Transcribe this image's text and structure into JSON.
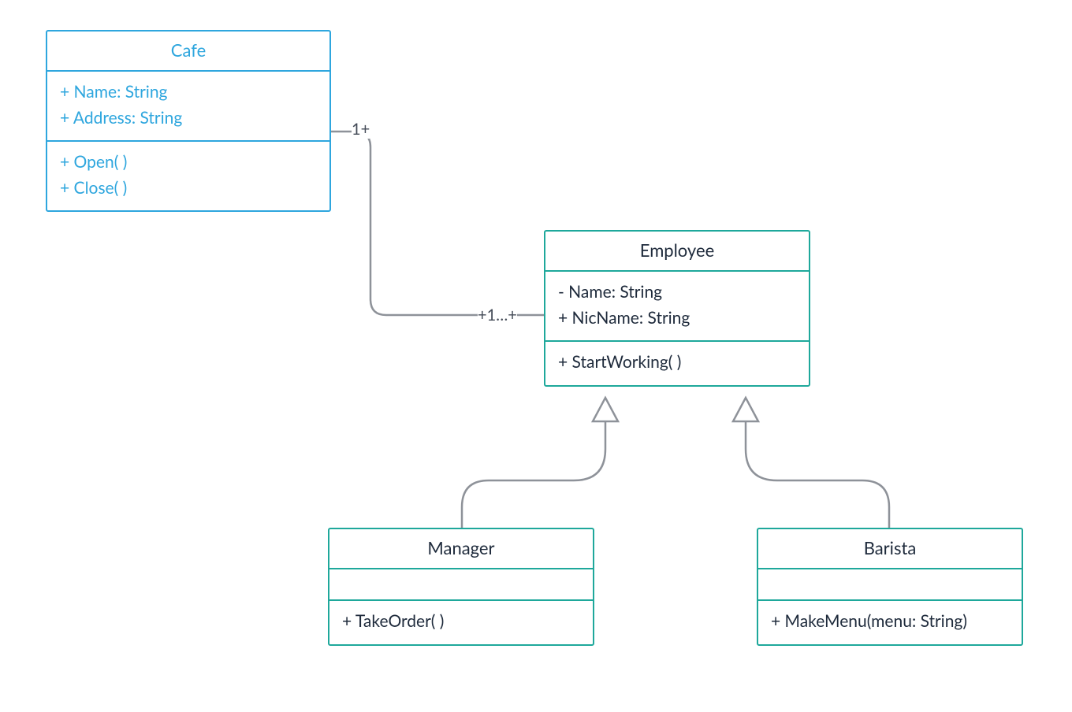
{
  "diagram": {
    "type": "uml-class-diagram",
    "classes": {
      "cafe": {
        "name": "Cafe",
        "attributes": [
          "+ Name: String",
          "+ Address: String"
        ],
        "operations": [
          "+ Open( )",
          "+ Close( )"
        ]
      },
      "employee": {
        "name": "Employee",
        "attributes": [
          "- Name: String",
          "+ NicName: String"
        ],
        "operations": [
          "+ StartWorking( )"
        ]
      },
      "manager": {
        "name": "Manager",
        "attributes": [],
        "operations": [
          "+ TakeOrder( )"
        ]
      },
      "barista": {
        "name": "Barista",
        "attributes": [],
        "operations": [
          "+ MakeMenu(menu: String)"
        ]
      }
    },
    "relationships": [
      {
        "from": "cafe",
        "to": "employee",
        "type": "association",
        "from_multiplicity": "1+",
        "to_multiplicity": "+1…+"
      },
      {
        "from": "manager",
        "to": "employee",
        "type": "generalization"
      },
      {
        "from": "barista",
        "to": "employee",
        "type": "generalization"
      }
    ],
    "colors": {
      "cafe_border": "#2ea6de",
      "class_border": "#1ea89b",
      "connector": "#8e9299",
      "text": "#1e2a3b"
    }
  }
}
